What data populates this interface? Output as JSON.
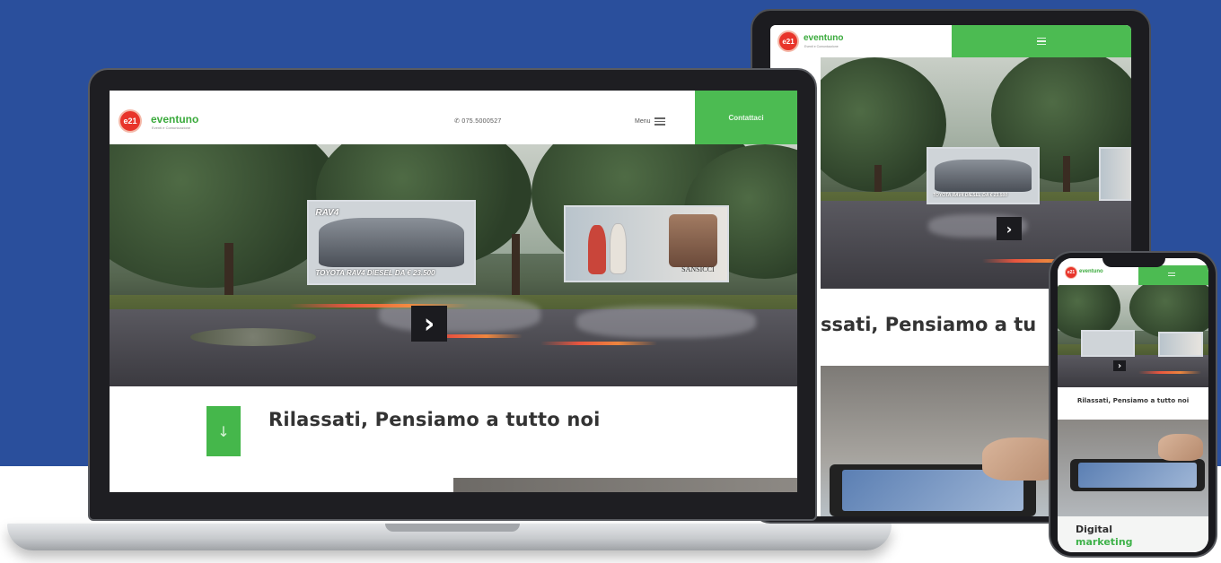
{
  "brand": {
    "name": "eventuno",
    "tagline": "Eventi e Comunicazione",
    "badge": "e21",
    "colors": {
      "green": "#4cbb52",
      "red": "#e8342a",
      "background_blue": "#2a4f9c"
    }
  },
  "laptop": {
    "phone": "075.5000527",
    "phone_icon": "phone-icon",
    "menu_label": "Menu",
    "menu_icon": "hamburger-icon",
    "cta_label": "Contattaci",
    "scroll_icon": "arrow-down-icon",
    "headline": "Rilassati, Pensiamo a tutto noi",
    "billboard_car_text": "TOYOTA RAV4 DIESEL DA € 23.500",
    "billboard_car_title": "RAV4",
    "billboard_fashion_label": "SANSICCI"
  },
  "tablet": {
    "menu_icon": "hamburger-icon",
    "headline": "ssati, Pensiamo a tu",
    "billboard_car_text": "TOYOTA RAV4 DIESEL DA € 23.500"
  },
  "phone": {
    "menu_icon": "hamburger-icon",
    "headline": "Rilassati, Pensiamo a tutto noi",
    "section_title_1": "Digital",
    "section_title_2": "marketing"
  }
}
